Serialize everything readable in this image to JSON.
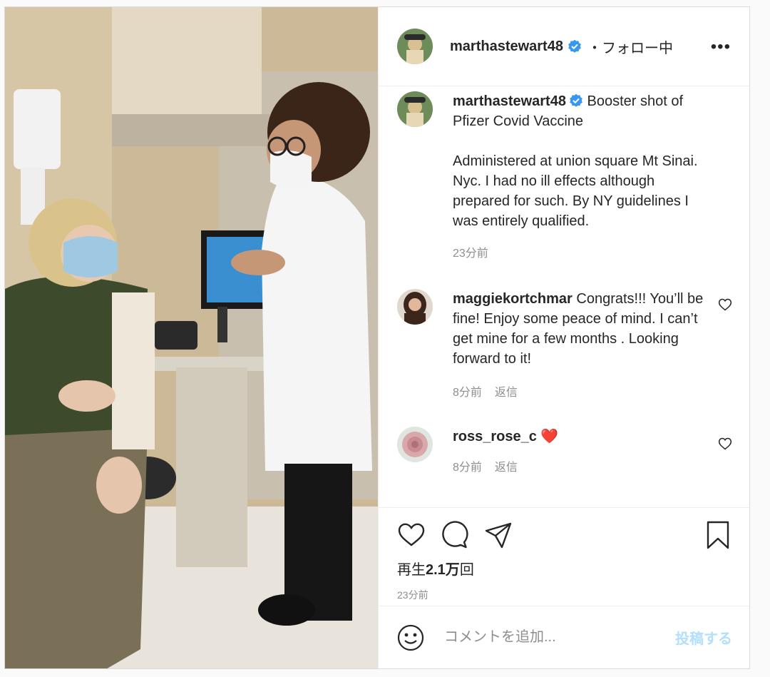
{
  "header": {
    "username": "marthastewart48",
    "following": "・フォロー中",
    "more": "•••"
  },
  "caption": {
    "username": "marthastewart48",
    "text_line1": " Booster shot of Pfizer Covid Vaccine",
    "text_para2": "Administered at union square Mt Sinai. Nyc. I had no ill effects although prepared for such. By NY guidelines I was entirely qualified.",
    "time": "23分前"
  },
  "comments": [
    {
      "username": "maggiekortchmar",
      "text": " Congrats!!! You’ll be fine! Enjoy some peace of mind. I can’t get mine for a few months . Looking forward to it!",
      "time": "8分前",
      "reply": "返信"
    },
    {
      "username": "ross_rose_c",
      "text": " ❤️",
      "time": "8分前",
      "reply": "返信"
    }
  ],
  "actions": {
    "views_prefix": "再生",
    "views_count": "2.1万",
    "views_suffix": "回",
    "time": "23分前"
  },
  "add_comment": {
    "placeholder": "コメントを追加...",
    "post_label": "投稿する"
  },
  "colors": {
    "verified": "#3897f0",
    "post_button_disabled": "#b2dffc",
    "heart_red": "#ed1c24"
  },
  "icons": [
    "verified-icon",
    "more-icon",
    "heart-icon",
    "comment-icon",
    "share-icon",
    "bookmark-icon",
    "emoji-icon"
  ]
}
